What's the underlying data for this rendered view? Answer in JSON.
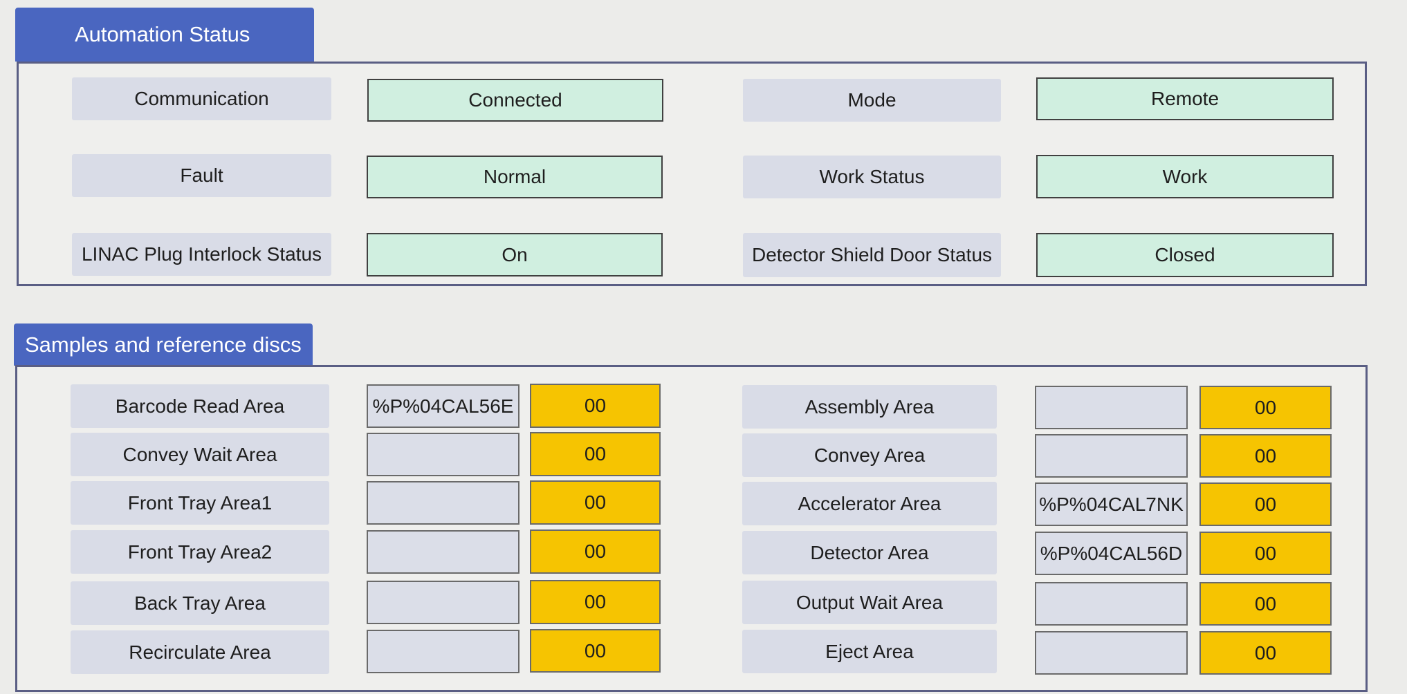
{
  "automation": {
    "title": "Automation Status",
    "rows": [
      {
        "left_label": "Communication",
        "left_value": "Connected",
        "right_label": "Mode",
        "right_value": "Remote"
      },
      {
        "left_label": "Fault",
        "left_value": "Normal",
        "right_label": "Work Status",
        "right_value": "Work"
      },
      {
        "left_label": "LINAC Plug Interlock Status",
        "left_value": "On",
        "right_label": "Detector Shield Door Status",
        "right_value": "Closed"
      }
    ],
    "value_color": "#d0efe0"
  },
  "samples": {
    "title": "Samples and reference discs",
    "count_color": "#f6c401",
    "left_rows": [
      {
        "label": "Barcode Read Area",
        "code": "%P%04CAL56E",
        "count": "00"
      },
      {
        "label": "Convey Wait Area",
        "code": "",
        "count": "00"
      },
      {
        "label": "Front Tray Area1",
        "code": "",
        "count": "00"
      },
      {
        "label": "Front Tray Area2",
        "code": "",
        "count": "00"
      },
      {
        "label": "Back Tray Area",
        "code": "",
        "count": "00"
      },
      {
        "label": "Recirculate Area",
        "code": "",
        "count": "00"
      }
    ],
    "right_rows": [
      {
        "label": "Assembly Area",
        "code": "",
        "count": "00"
      },
      {
        "label": "Convey Area",
        "code": "",
        "count": "00"
      },
      {
        "label": "Accelerator Area",
        "code": "%P%04CAL7NK",
        "count": "00"
      },
      {
        "label": "Detector Area",
        "code": "%P%04CAL56D",
        "count": "00"
      },
      {
        "label": "Output Wait Area",
        "code": "",
        "count": "00"
      },
      {
        "label": "Eject Area",
        "code": "",
        "count": "00"
      }
    ]
  }
}
